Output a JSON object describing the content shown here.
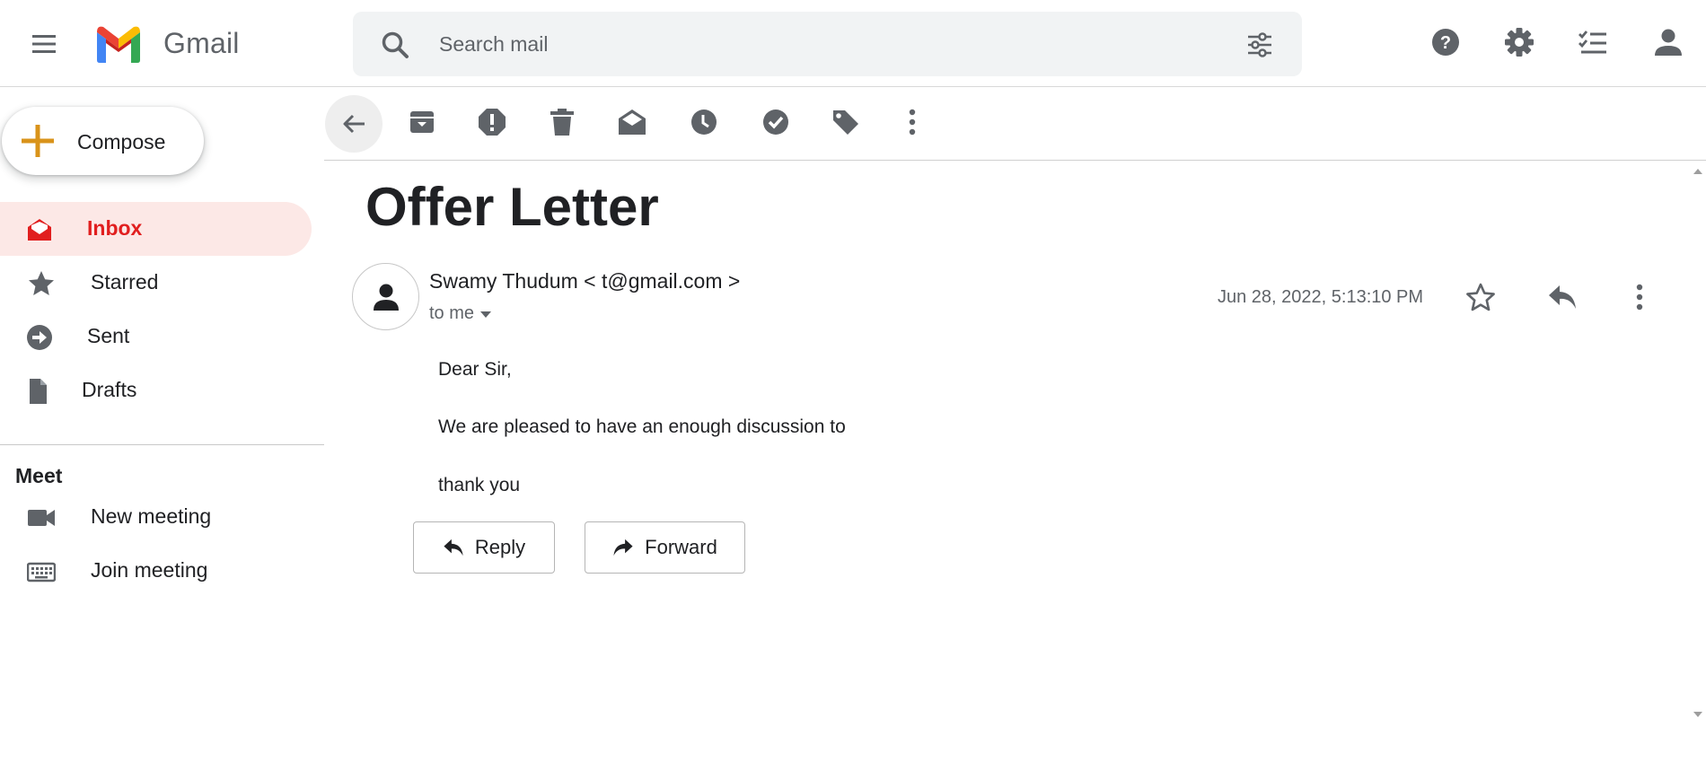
{
  "app": {
    "brand": "Gmail",
    "colors": {
      "accent_red": "#e11f1f",
      "active_bg": "#fce8e6",
      "compose_plus": "#d9931a",
      "icon_gray": "#5f6368"
    }
  },
  "header": {
    "menu_icon": "hamburger-menu-icon",
    "search": {
      "placeholder": "Search mail",
      "value": ""
    },
    "icons": [
      "help-icon",
      "settings-icon",
      "tasks-icon",
      "account-icon"
    ]
  },
  "sidebar": {
    "compose_label": "Compose",
    "items": [
      {
        "label": "Inbox",
        "icon": "inbox-icon",
        "active": true
      },
      {
        "label": "Starred",
        "icon": "star-icon",
        "active": false
      },
      {
        "label": "Sent",
        "icon": "sent-icon",
        "active": false
      },
      {
        "label": "Drafts",
        "icon": "drafts-icon",
        "active": false
      }
    ],
    "meet": {
      "title": "Meet",
      "items": [
        {
          "label": "New meeting",
          "icon": "video-camera-icon"
        },
        {
          "label": "Join meeting",
          "icon": "keyboard-icon"
        }
      ]
    }
  },
  "toolbar": {
    "icons": [
      "back-arrow-icon",
      "archive-icon",
      "report-spam-icon",
      "delete-icon",
      "mark-unread-icon",
      "snooze-icon",
      "add-to-tasks-icon",
      "label-icon",
      "more-vert-icon"
    ]
  },
  "message": {
    "subject": "Offer Letter",
    "sender": "Swamy Thudum < t@gmail.com >",
    "recipient": "to me",
    "date": "Jun 28, 2022, 5:13:10 PM",
    "body": [
      "Dear Sir,",
      "We are pleased to have an enough discussion to",
      "thank you"
    ],
    "reply_label": "Reply",
    "forward_label": "Forward"
  }
}
